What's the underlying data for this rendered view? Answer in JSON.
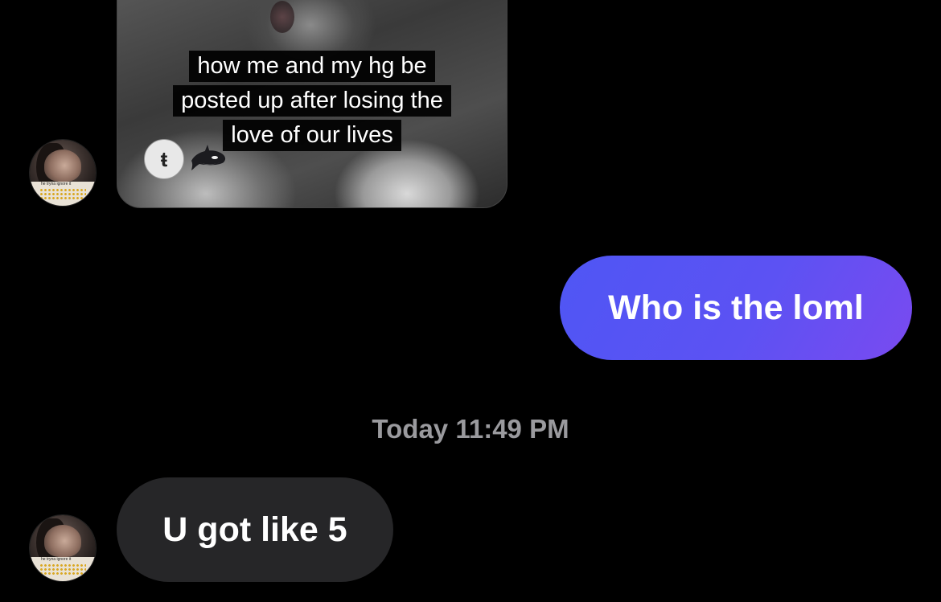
{
  "messages": [
    {
      "type": "shared_reel",
      "direction": "received",
      "caption_lines": [
        "how me and my hg be",
        "posted up after losing the",
        "love of our lives"
      ],
      "reel_account_icon": "tiktok-style-account-avatar",
      "reaction_icon": "orca-emoji"
    },
    {
      "type": "text",
      "direction": "sent",
      "text": "Who is the loml",
      "color": "#5c52f3"
    },
    {
      "type": "timestamp",
      "text": "Today 11:49 PM"
    },
    {
      "type": "text",
      "direction": "received",
      "text": "U got like 5",
      "color": "#262628"
    }
  ],
  "contact": {
    "avatar_icon": "profile-photo",
    "avatar_caption": "he tryna ignore it"
  },
  "reel_avatar_glyph": "ŧ"
}
